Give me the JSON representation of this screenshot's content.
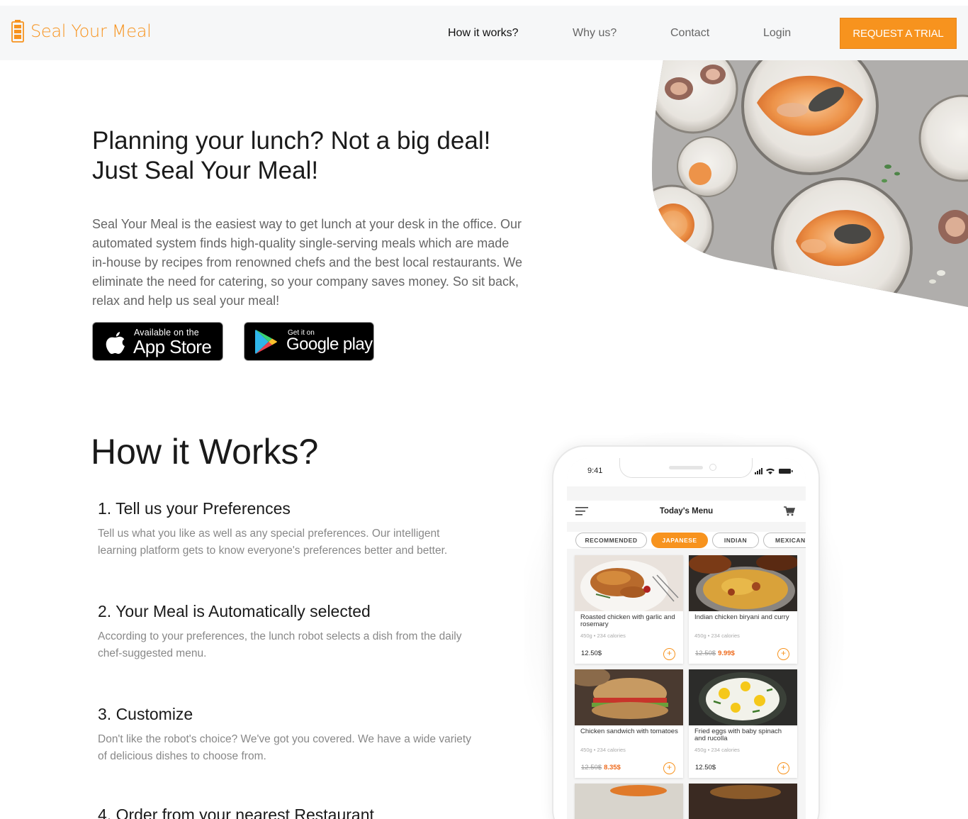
{
  "brand": {
    "name": "Seal Your Meal",
    "accent": "#f7931e"
  },
  "nav": {
    "links": [
      "How it works?",
      "Why us?",
      "Contact",
      "Login"
    ],
    "cta": "REQUEST A TRIAL"
  },
  "hero": {
    "title_line1": "Planning your lunch? Not a big deal!",
    "title_line2": "Just Seal Your Meal!",
    "description": "Seal Your Meal is the easiest way to get lunch at your desk in the office. Our automated system finds high-quality single-serving meals which are made in-house by recipes from renowned chefs and the best local restaurants. We eliminate the need for catering, so your company saves money. So sit back, relax and help us seal your meal!",
    "app_store": {
      "small": "Available on the",
      "big": "App Store"
    },
    "google_play": {
      "small": "Get it on",
      "big": "Google play"
    }
  },
  "how": {
    "title": "How it Works?",
    "steps": [
      {
        "title": "1. Tell us your Preferences",
        "desc": "Tell us what you like as well as any special preferences. Our intelligent learning platform gets to know everyone's preferences better and better."
      },
      {
        "title": "2. Your Meal is Automatically selected",
        "desc": "According to your preferences, the lunch robot selects a dish from the daily chef-suggested menu."
      },
      {
        "title": "3. Customize",
        "desc": "Don't like the robot's choice? We've got you covered. We have a wide variety of delicious dishes to choose from."
      },
      {
        "title": "4. Order from your nearest Restaurant",
        "desc": ""
      }
    ]
  },
  "phone": {
    "time": "9:41",
    "title": "Today's Menu",
    "chips": [
      "RECOMMENDED",
      "JAPANESE",
      "INDIAN",
      "MEXICAN"
    ],
    "active_chip": "JAPANESE",
    "cards": [
      {
        "name": "Roasted chicken with garlic and rosemary",
        "meta": "450g • 234 calories",
        "old_price": "",
        "price": "12.50$"
      },
      {
        "name": "Indian chicken biryani and curry",
        "meta": "450g • 234 calories",
        "old_price": "12.50$",
        "price": "9.99$"
      },
      {
        "name": "Chicken sandwich with tomatoes",
        "meta": "450g • 234 calories",
        "old_price": "12.50$",
        "price": "8.35$"
      },
      {
        "name": "Fried eggs with baby spinach and rucolla",
        "meta": "450g • 234 calories",
        "old_price": "",
        "price": "12.50$"
      }
    ],
    "add_symbol": "+"
  }
}
